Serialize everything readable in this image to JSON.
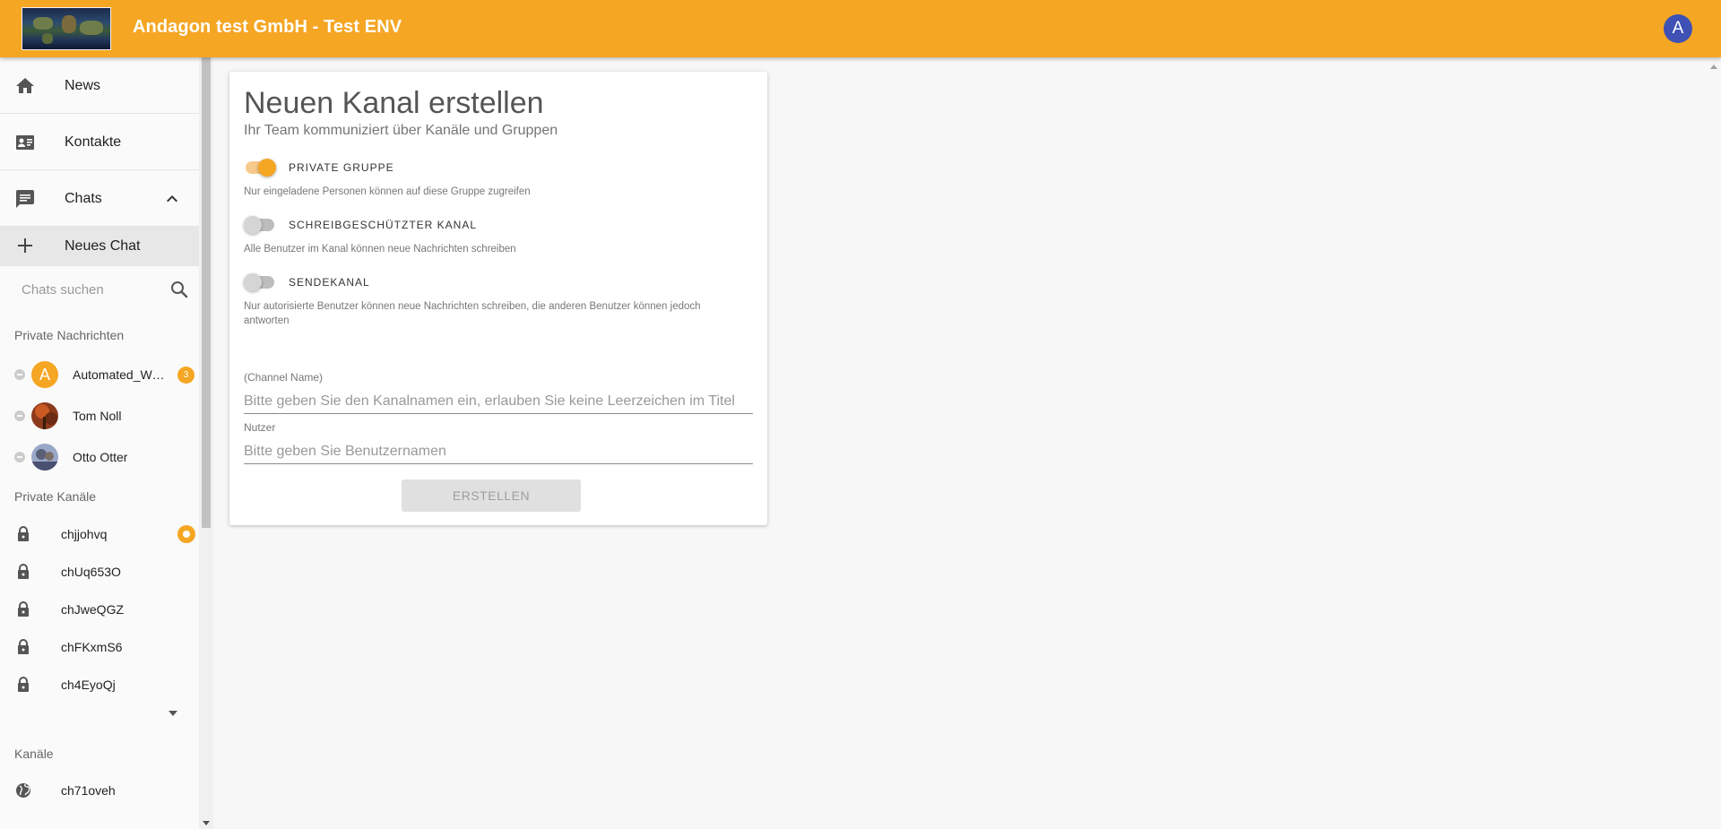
{
  "header": {
    "title": "Andagon test GmbH - Test ENV",
    "user_initial": "A",
    "brand_color": "#f5a623",
    "avatar_color": "#3f51b5"
  },
  "sidebar": {
    "nav": [
      {
        "label": "News",
        "icon": "home-icon"
      },
      {
        "label": "Kontakte",
        "icon": "contact-card-icon"
      },
      {
        "label": "Chats",
        "icon": "chat-icon",
        "expanded": true
      }
    ],
    "new_chat_label": "Neues Chat",
    "search_placeholder": "Chats suchen",
    "private_messages": {
      "heading": "Private Nachrichten",
      "items": [
        {
          "name": "Automated_Webtest",
          "avatar_initial": "A",
          "badge": "3",
          "status": "offline"
        },
        {
          "name": "Tom Noll",
          "status": "offline"
        },
        {
          "name": "Otto Otter",
          "status": "offline"
        }
      ]
    },
    "private_channels": {
      "heading": "Private Kanäle",
      "items": [
        {
          "name": "chjjohvq",
          "unread": true
        },
        {
          "name": "chUq653O"
        },
        {
          "name": "chJweQGZ"
        },
        {
          "name": "chFKxmS6"
        },
        {
          "name": "ch4EyoQj"
        }
      ]
    },
    "channels": {
      "heading": "Kanäle",
      "items": [
        {
          "name": "ch71oveh"
        }
      ]
    }
  },
  "form": {
    "title": "Neuen Kanal erstellen",
    "subtitle": "Ihr Team kommuniziert über Kanäle und Gruppen",
    "toggles": [
      {
        "label": "PRIVATE GRUPPE",
        "on": true,
        "help": "Nur eingeladene Personen können auf diese Gruppe zugreifen"
      },
      {
        "label": "SCHREIBGESCHÜTZTER KANAL",
        "on": false,
        "help": "Alle Benutzer im Kanal können neue Nachrichten schreiben"
      },
      {
        "label": "SENDEKANAL",
        "on": false,
        "help": "Nur autorisierte Benutzer können neue Nachrichten schreiben, die anderen Benutzer können jedoch antworten"
      }
    ],
    "channel_name": {
      "label": "(Channel Name)",
      "placeholder": "Bitte geben Sie den Kanalnamen ein, erlauben Sie keine Leerzeichen im Titel",
      "value": ""
    },
    "users": {
      "label": "Nutzer",
      "placeholder": "Bitte geben Sie Benutzernamen",
      "value": ""
    },
    "create_label": "ERSTELLEN"
  }
}
